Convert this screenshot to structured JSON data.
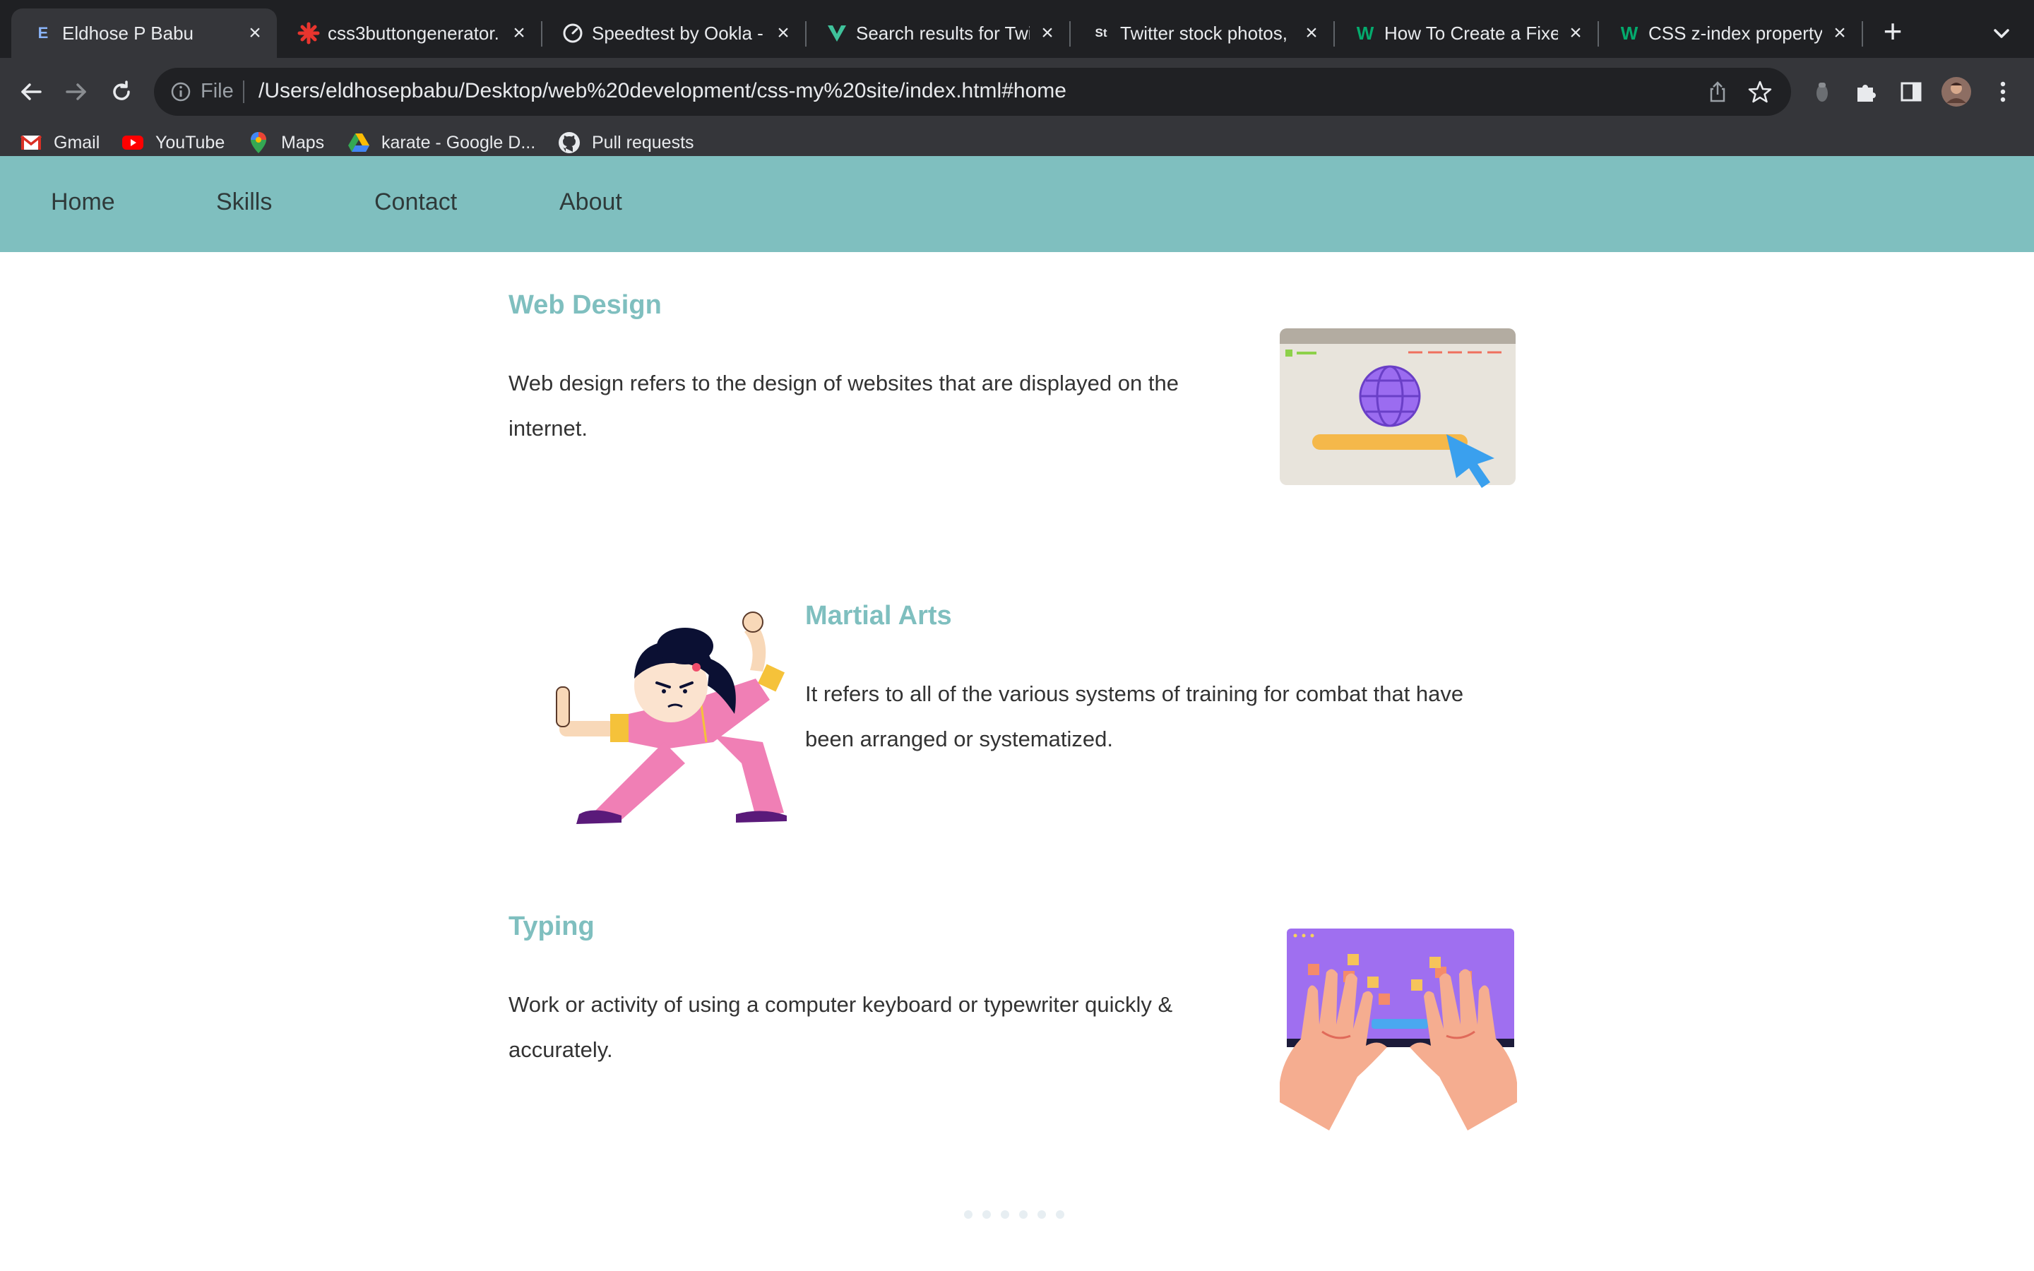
{
  "browser": {
    "tabs": [
      {
        "title": "Eldhose P Babu",
        "favicon": "letter-e-icon",
        "favicon_text": "E",
        "active": true
      },
      {
        "title": "css3buttongenerator.",
        "favicon": "red-star-icon"
      },
      {
        "title": "Speedtest by Ookla -",
        "favicon": "speedometer-icon"
      },
      {
        "title": "Search results for Twi",
        "favicon": "vecteezy-icon"
      },
      {
        "title": "Twitter stock photos,",
        "favicon": "shutterstock-icon",
        "favicon_text": "St"
      },
      {
        "title": "How To Create a Fixed",
        "favicon": "w3schools-icon",
        "favicon_text": "W"
      },
      {
        "title": "CSS z-index property",
        "favicon": "w3schools-icon",
        "favicon_text": "W"
      }
    ],
    "new_tab_label": "+",
    "address": {
      "scheme": "File",
      "url": "/Users/eldhosepbabu/Desktop/web%20development/css-my%20site/index.html#home"
    },
    "bookmarks": [
      {
        "label": "Gmail",
        "icon": "gmail-icon"
      },
      {
        "label": "YouTube",
        "icon": "youtube-icon"
      },
      {
        "label": "Maps",
        "icon": "maps-icon"
      },
      {
        "label": "karate - Google D...",
        "icon": "google-drive-icon"
      },
      {
        "label": "Pull requests",
        "icon": "github-icon"
      }
    ]
  },
  "site": {
    "nav": [
      "Home",
      "Skills",
      "Contact",
      "About"
    ],
    "sections": [
      {
        "title": "Web Design",
        "lines": [
          "Web design refers to the design of websites that are displayed on the",
          "internet."
        ]
      },
      {
        "title": "Martial Arts",
        "lines": [
          "It refers to all of the various systems of training for combat that have",
          "been arranged or systematized."
        ]
      },
      {
        "title": "Typing",
        "lines": [
          "Work or activity of using a computer keyboard or typewriter quickly &",
          "accurately."
        ]
      }
    ]
  },
  "colors": {
    "accent": "#7fbfbf",
    "chrome_dark": "#1f2023",
    "chrome_toolbar": "#35363a"
  }
}
